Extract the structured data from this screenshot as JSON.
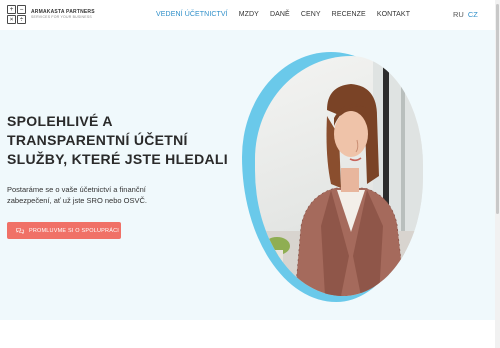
{
  "brand": {
    "name": "ARMAKASTA PARTNERS",
    "tagline": "SERVICES FOR YOUR BUSINESS",
    "logo_glyphs": [
      "+",
      "−",
      "×",
      "÷"
    ]
  },
  "nav": {
    "items": [
      {
        "label": "VEDENÍ ÚČETNICTVÍ",
        "active": true
      },
      {
        "label": "MZDY",
        "active": false
      },
      {
        "label": "DANĚ",
        "active": false
      },
      {
        "label": "CENY",
        "active": false
      },
      {
        "label": "RECENZE",
        "active": false
      },
      {
        "label": "KONTAKT",
        "active": false
      }
    ]
  },
  "languages": [
    {
      "label": "RU",
      "active": false
    },
    {
      "label": "CZ",
      "active": true
    }
  ],
  "hero": {
    "title_lines": [
      "SPOLEHLIVÉ A",
      "TRANSPARENTNÍ ÚČETNÍ",
      "SLUŽBY, KTERÉ JSTE HLEDALI"
    ],
    "lead": "Postaráme se o vaše účetnictví a finanční zabezpečení, ať už jste SRO nebo OSVČ.",
    "cta_label": "PROMLUVME SI O SPOLUPRÁCI",
    "cta_icon": "chat-bubbles-icon",
    "image_icon": "woman-portrait-photo"
  },
  "colors": {
    "accent": "#2f8fc9",
    "cta": "#f07167",
    "hero_bg": "#f0f9fc",
    "blob": "#6ac9ea"
  }
}
